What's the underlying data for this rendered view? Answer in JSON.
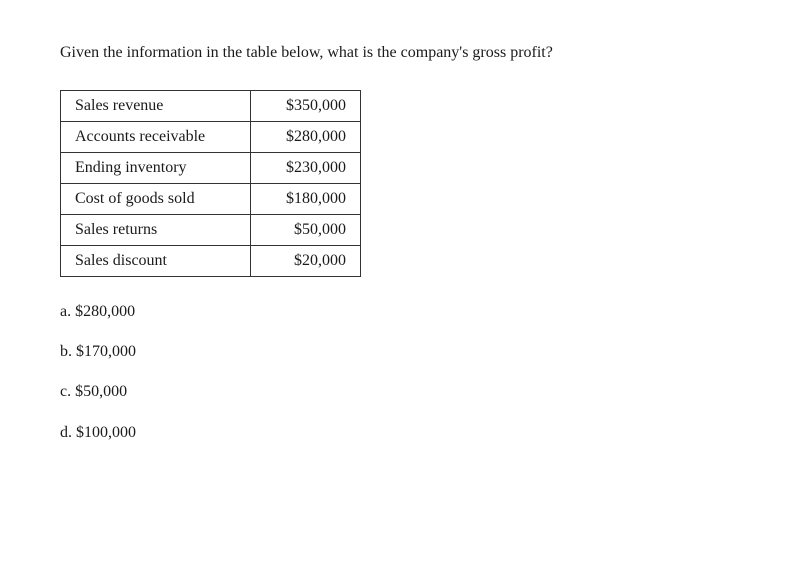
{
  "question": {
    "text": "Given the information in the table below, what is the company's gross profit?"
  },
  "table": {
    "rows": [
      {
        "label": "Sales revenue",
        "value": "$350,000"
      },
      {
        "label": "Accounts receivable",
        "value": "$280,000"
      },
      {
        "label": "Ending inventory",
        "value": "$230,000"
      },
      {
        "label": "Cost of goods sold",
        "value": "$180,000"
      },
      {
        "label": "Sales returns",
        "value": "$50,000"
      },
      {
        "label": "Sales discount",
        "value": "$20,000"
      }
    ]
  },
  "answers": [
    {
      "letter": "a.",
      "value": "$280,000"
    },
    {
      "letter": "b.",
      "value": "$170,000"
    },
    {
      "letter": "c.",
      "value": "$50,000"
    },
    {
      "letter": "d.",
      "value": "$100,000"
    }
  ]
}
